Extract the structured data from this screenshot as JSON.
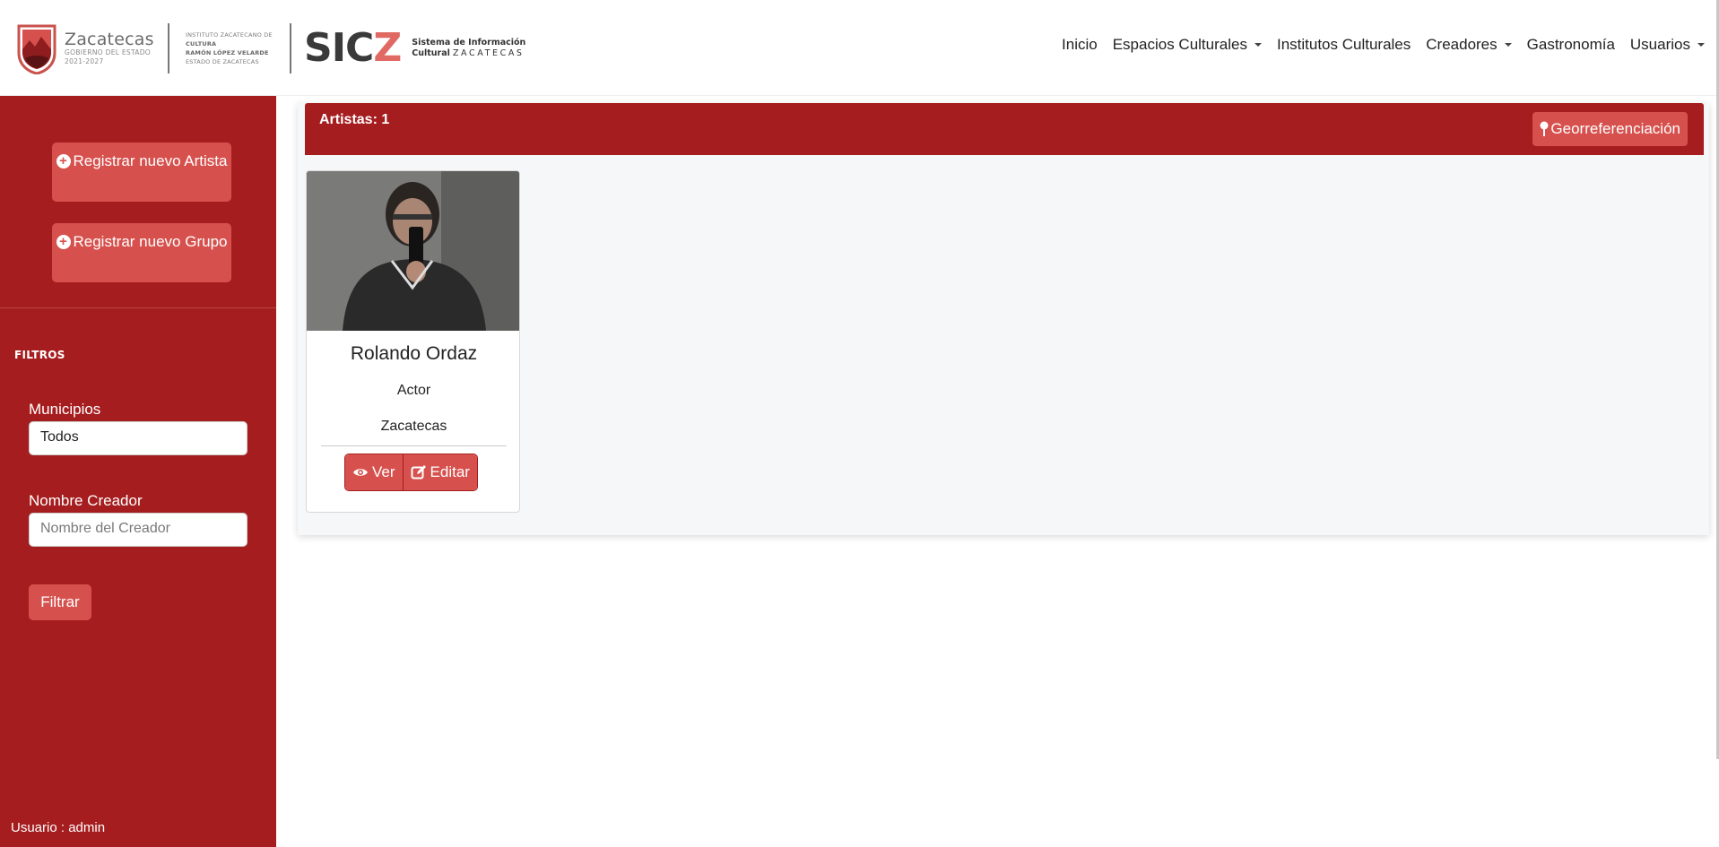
{
  "header": {
    "gov": {
      "title": "Zacatecas",
      "sub1": "GOBIERNO DEL ESTADO",
      "sub2": "2021-2027"
    },
    "institute": {
      "line1": "INSTITUTO ZACATECANO DE",
      "line2": "CULTURA",
      "line3": "RAMÓN LÓPEZ VELARDE",
      "line4": "ESTADO DE ZACATECAS"
    },
    "sicz": {
      "logo_main": "SIC",
      "logo_z": "Z",
      "line1": "Sistema de Información",
      "line2a": "Cultural",
      "line2b": "ZACATECAS"
    },
    "nav": [
      {
        "label": "Inicio"
      },
      {
        "label": "Espacios Culturales"
      },
      {
        "label": "Institutos Culturales"
      },
      {
        "label": "Creadores"
      },
      {
        "label": "Gastronomía"
      },
      {
        "label": "Usuarios"
      }
    ]
  },
  "sidebar": {
    "btn_artista": "Registrar nuevo Artista",
    "btn_grupo": "Registrar nuevo Grupo",
    "filters_title": "FILTROS",
    "municipios_label": "Municipios",
    "municipios_value": "Todos",
    "nombre_label": "Nombre Creador",
    "nombre_placeholder": "Nombre del Creador",
    "filtrar": "Filtrar",
    "usuario": "Usuario : admin"
  },
  "main": {
    "count_label": "Artistas: 1",
    "georef": "Georreferenciación",
    "cards": [
      {
        "name": "Rolando Ordaz",
        "role": "Actor",
        "municipality": "Zacatecas",
        "ver": "Ver",
        "editar": "Editar"
      }
    ]
  },
  "colors": {
    "brand_red": "#a61d1f",
    "button_red": "#d6514d",
    "accent_coral": "#e06a63"
  }
}
